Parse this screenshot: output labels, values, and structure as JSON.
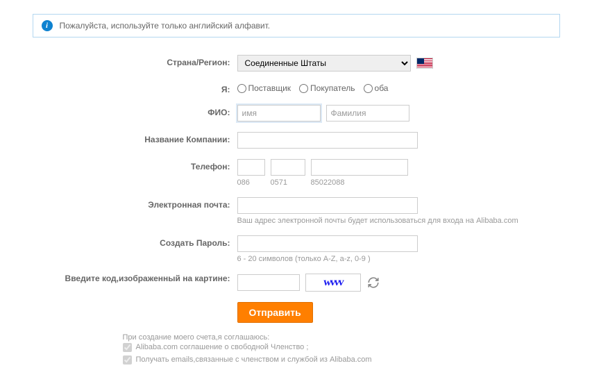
{
  "banner": {
    "text": "Пожалуйста, используйте только английский алфавит."
  },
  "labels": {
    "country": "Страна/Регион:",
    "iam": "Я:",
    "fullname": "ФИО:",
    "company": "Название Компании:",
    "phone": "Телефон:",
    "email": "Электронная почта:",
    "password": "Создать Пароль:",
    "captcha": "Введите код,изображенный на картине:"
  },
  "country": {
    "selected": "Соединенные Штаты"
  },
  "roles": {
    "supplier": "Поставщик",
    "buyer": "Покупатель",
    "both": "оба"
  },
  "name": {
    "first_placeholder": "имя",
    "last_placeholder": "Фамилия"
  },
  "phone_hints": {
    "p1": "086",
    "p2": "0571",
    "p3": "85022088"
  },
  "email_hint": "Ваш адрес электронной почты будет использоваться для входа на Alibaba.com",
  "password_hint": "6 - 20 символов (только A-Z, a-z, 0-9 )",
  "captcha_value": "wvvv",
  "submit": "Отправить",
  "agreements": {
    "intro": "При создание моего счета,я соглашаюсь:",
    "line1": "Alibaba.com соглашение о свободной Членство ;",
    "line2": "Получать emails,связанные с членством и службой из Alibaba.com"
  }
}
